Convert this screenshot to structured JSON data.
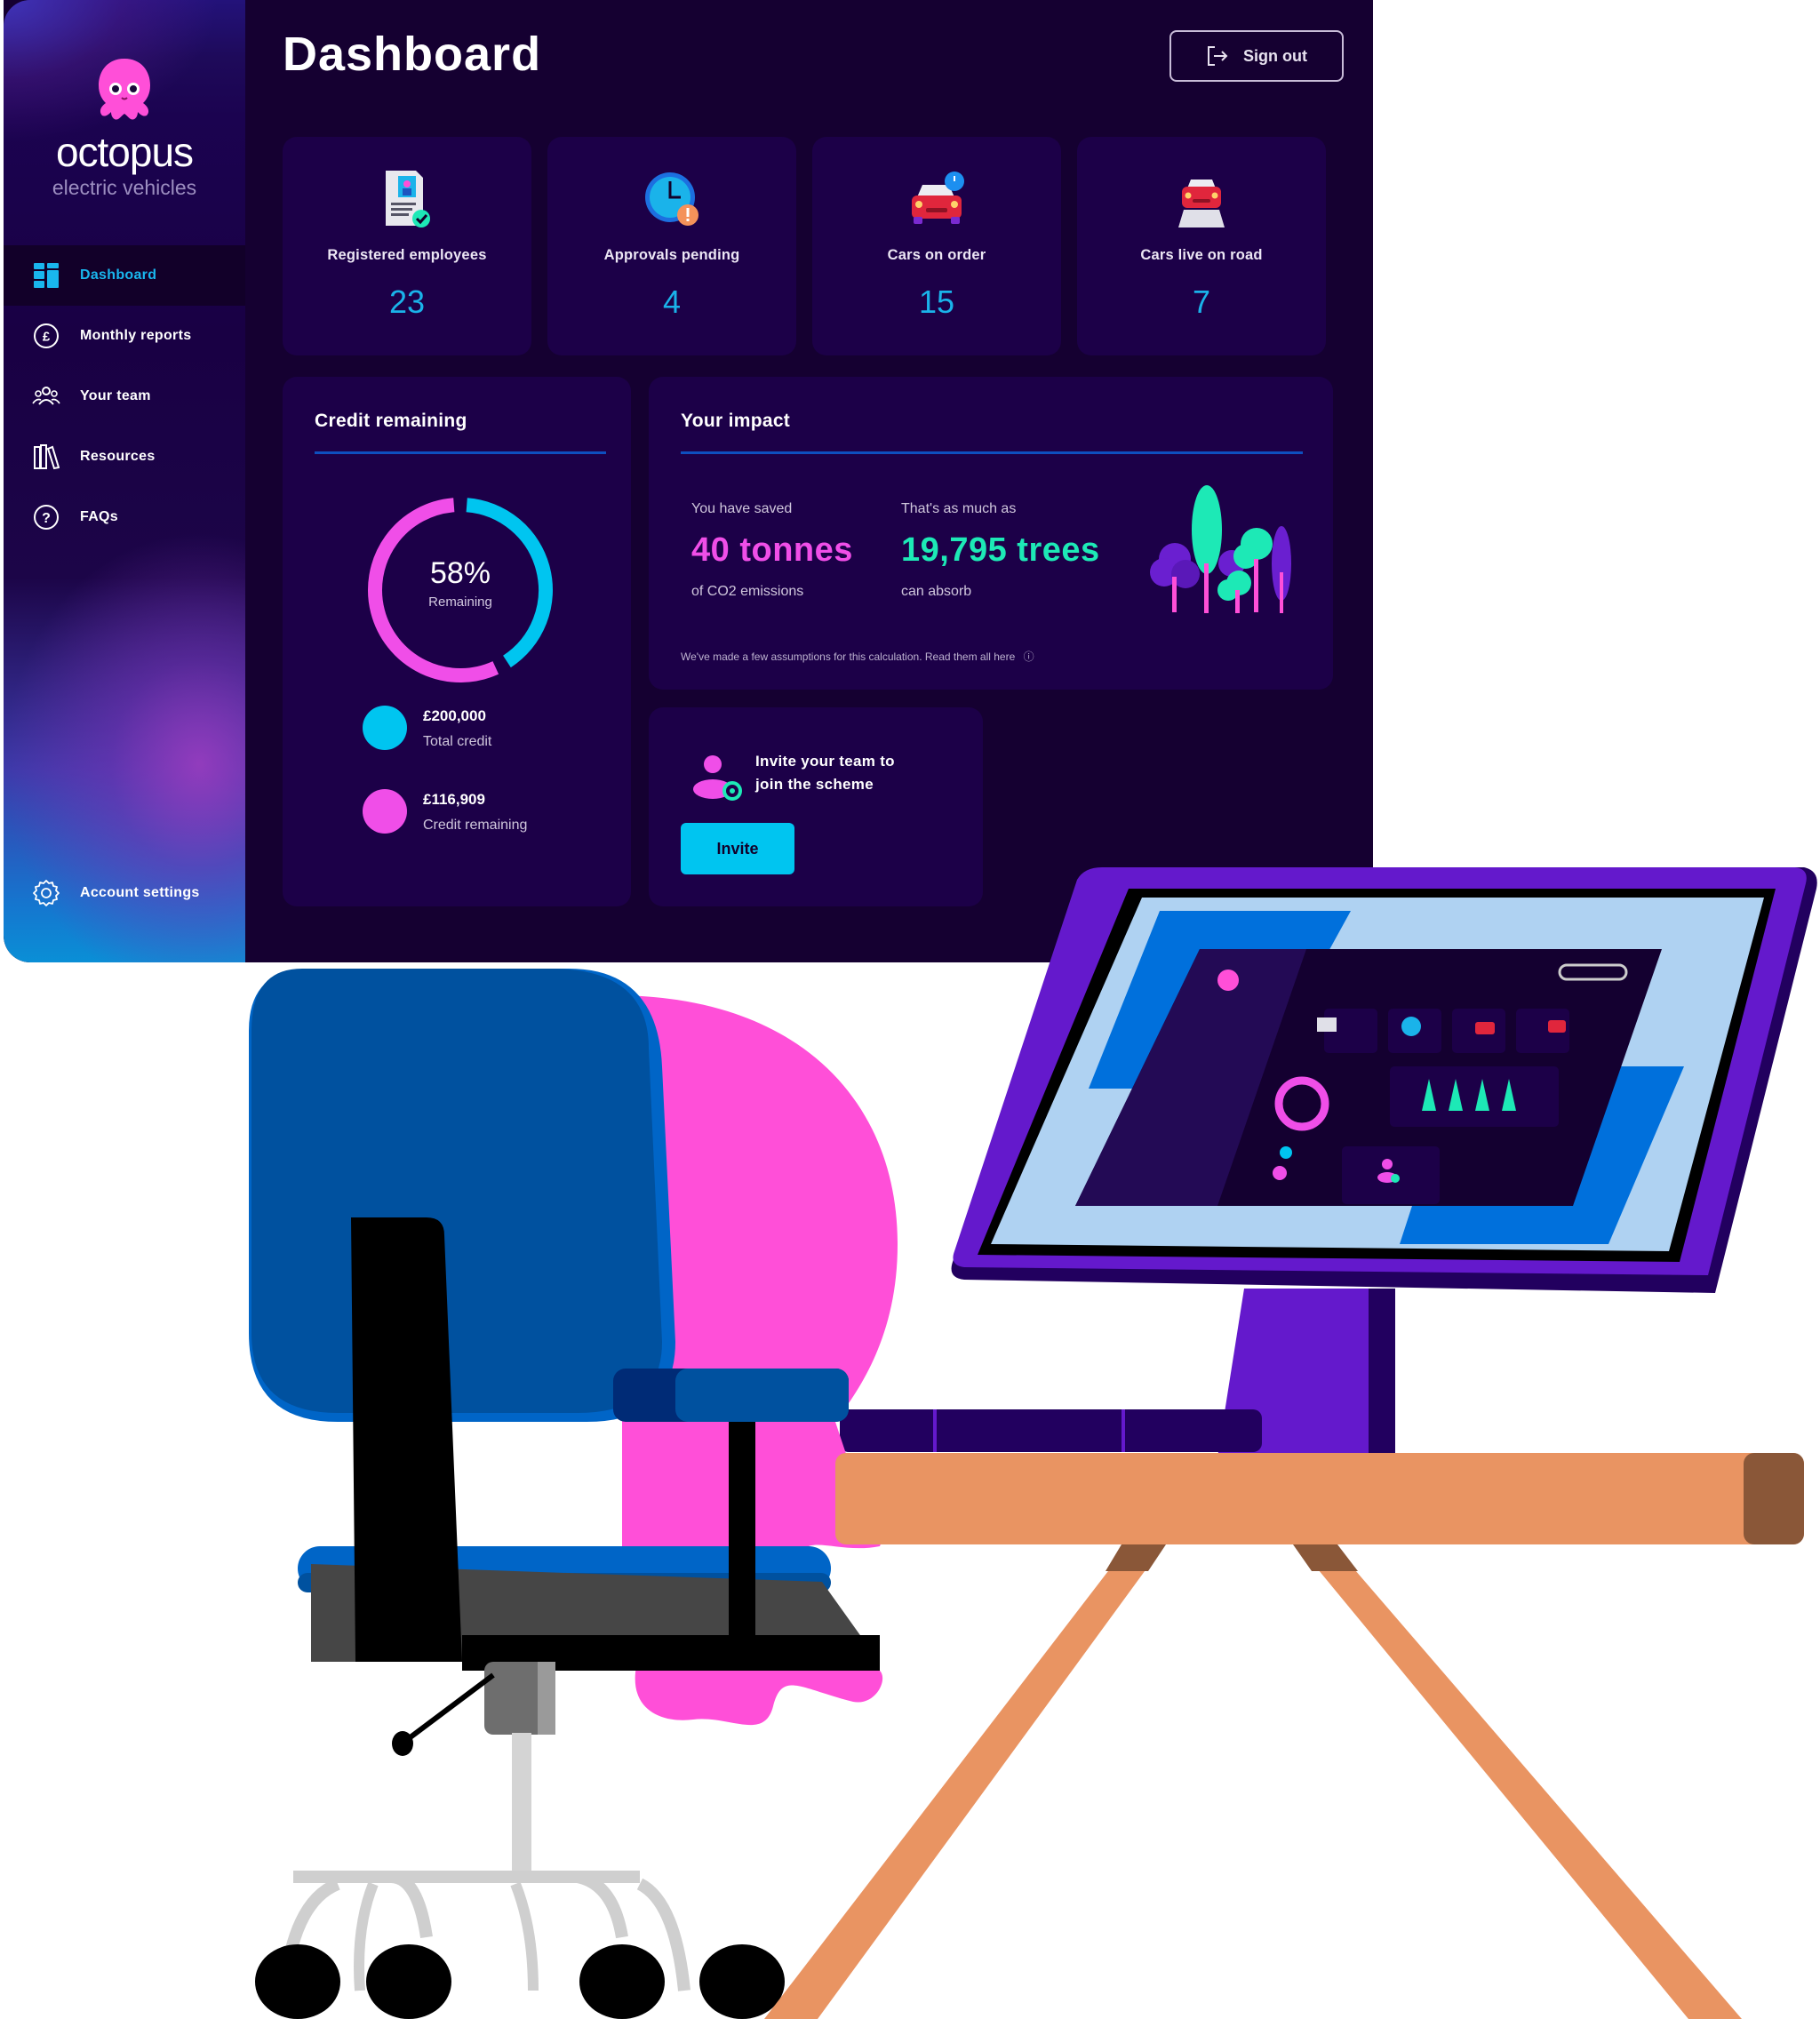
{
  "brand": {
    "name": "octopus",
    "subtitle": "electric vehicles",
    "logo_icon": "octopus-mascot-icon"
  },
  "sidebar": {
    "items": [
      {
        "label": "Dashboard",
        "icon": "dashboard-grid-icon",
        "active": true
      },
      {
        "label": "Monthly reports",
        "icon": "pound-coin-icon",
        "active": false
      },
      {
        "label": "Your team",
        "icon": "team-icon",
        "active": false
      },
      {
        "label": "Resources",
        "icon": "books-icon",
        "active": false
      },
      {
        "label": "FAQs",
        "icon": "question-circle-icon",
        "active": false
      }
    ],
    "account": {
      "label": "Account settings",
      "icon": "gear-icon"
    }
  },
  "header": {
    "title": "Dashboard",
    "signout_label": "Sign out",
    "signout_icon": "sign-out-icon"
  },
  "stats": [
    {
      "label": "Registered employees",
      "value": "23",
      "icon": "document-check-icon"
    },
    {
      "label": "Approvals pending",
      "value": "4",
      "icon": "clock-alert-icon"
    },
    {
      "label": "Cars on order",
      "value": "15",
      "icon": "car-clock-icon"
    },
    {
      "label": "Cars live on road",
      "value": "7",
      "icon": "car-road-icon"
    }
  ],
  "credit": {
    "title": "Credit remaining",
    "percent_label": "58%",
    "percent_sub": "Remaining",
    "remaining_fraction": 0.58,
    "legend": [
      {
        "value": "£200,000",
        "label": "Total credit",
        "color": "#00c5f0"
      },
      {
        "value": "£116,909",
        "label": "Credit remaining",
        "color": "#f04ee8"
      }
    ]
  },
  "impact": {
    "title": "Your impact",
    "saved_pre": "You have saved",
    "saved_value": "40 tonnes",
    "saved_post": "of CO2 emissions",
    "trees_pre": "That's as much as",
    "trees_value": "19,795 trees",
    "trees_post": "can absorb",
    "note": "We've made a few assumptions for this calculation. Read them all here",
    "note_icon": "info-icon"
  },
  "invite": {
    "text_line1": "Invite your team to",
    "text_line2": "join the scheme",
    "button_label": "Invite",
    "icon": "add-user-icon"
  },
  "colors": {
    "background": "#150031",
    "card": "#1c0048",
    "accent_cyan": "#00c5f0",
    "accent_pink": "#f04ee8",
    "accent_green": "#1de9b6",
    "rule_blue": "#0e4fbf"
  }
}
